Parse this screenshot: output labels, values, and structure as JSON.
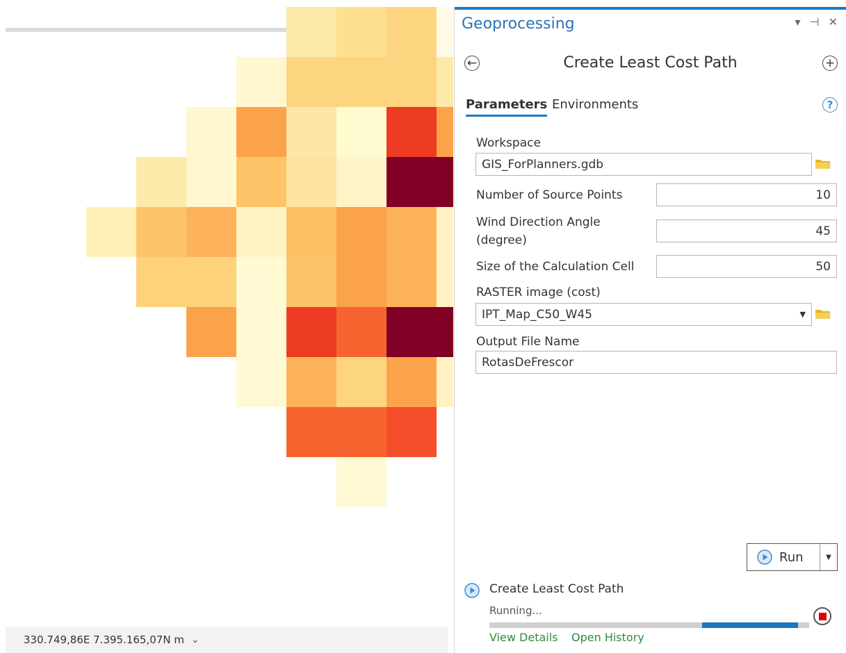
{
  "map": {
    "coordinates": "330.749,86E 7.395.165,07N m",
    "coord_dropdown_icon": "chevron-down-icon",
    "grid": [
      {
        "c": 5,
        "r": 0,
        "color": "#fde9a9"
      },
      {
        "c": 6,
        "r": 0,
        "color": "#fde08f"
      },
      {
        "c": 7,
        "r": 0,
        "color": "#fdd580"
      },
      {
        "c": 8,
        "r": 0,
        "color": "#fffbe6"
      },
      {
        "c": 4,
        "r": 1,
        "color": "#fff7cf"
      },
      {
        "c": 5,
        "r": 1,
        "color": "#fdd580"
      },
      {
        "c": 6,
        "r": 1,
        "color": "#fdd580"
      },
      {
        "c": 7,
        "r": 1,
        "color": "#fdd580"
      },
      {
        "c": 8,
        "r": 1,
        "color": "#fde9a9"
      },
      {
        "c": 3,
        "r": 2,
        "color": "#fff7cf"
      },
      {
        "c": 4,
        "r": 2,
        "color": "#fba34b"
      },
      {
        "c": 5,
        "r": 2,
        "color": "#fde6a7"
      },
      {
        "c": 6,
        "r": 2,
        "color": "#fffbd1"
      },
      {
        "c": 7,
        "r": 2,
        "color": "#ee3b23"
      },
      {
        "c": 8,
        "r": 2,
        "color": "#fba34b"
      },
      {
        "c": 2,
        "r": 3,
        "color": "#fde9a9"
      },
      {
        "c": 3,
        "r": 3,
        "color": "#fff7cf"
      },
      {
        "c": 4,
        "r": 3,
        "color": "#fdc46a"
      },
      {
        "c": 5,
        "r": 3,
        "color": "#fde3a0"
      },
      {
        "c": 6,
        "r": 3,
        "color": "#fff4c7"
      },
      {
        "c": 7,
        "r": 3,
        "color": "#800026"
      },
      {
        "c": 8,
        "r": 3,
        "color": "#800026"
      },
      {
        "c": 1,
        "r": 4,
        "color": "#fff0b8"
      },
      {
        "c": 2,
        "r": 4,
        "color": "#fdc46a"
      },
      {
        "c": 3,
        "r": 4,
        "color": "#fdb35a"
      },
      {
        "c": 4,
        "r": 4,
        "color": "#fff3c4"
      },
      {
        "c": 5,
        "r": 4,
        "color": "#fdbf63"
      },
      {
        "c": 6,
        "r": 4,
        "color": "#fba34b"
      },
      {
        "c": 7,
        "r": 4,
        "color": "#fdb35a"
      },
      {
        "c": 8,
        "r": 4,
        "color": "#fff3c4"
      },
      {
        "c": 2,
        "r": 5,
        "color": "#fdd27a"
      },
      {
        "c": 3,
        "r": 5,
        "color": "#fdd27a"
      },
      {
        "c": 4,
        "r": 5,
        "color": "#fffad4"
      },
      {
        "c": 5,
        "r": 5,
        "color": "#fdc46a"
      },
      {
        "c": 6,
        "r": 5,
        "color": "#fba34b"
      },
      {
        "c": 7,
        "r": 5,
        "color": "#fdb35a"
      },
      {
        "c": 8,
        "r": 5,
        "color": "#fff3c4"
      },
      {
        "c": 3,
        "r": 6,
        "color": "#fba34b"
      },
      {
        "c": 4,
        "r": 6,
        "color": "#fffad4"
      },
      {
        "c": 5,
        "r": 6,
        "color": "#ee3b23"
      },
      {
        "c": 6,
        "r": 6,
        "color": "#f8642f"
      },
      {
        "c": 7,
        "r": 6,
        "color": "#800026"
      },
      {
        "c": 8,
        "r": 6,
        "color": "#800026"
      },
      {
        "c": 4,
        "r": 7,
        "color": "#fffad4"
      },
      {
        "c": 5,
        "r": 7,
        "color": "#fdb35a"
      },
      {
        "c": 6,
        "r": 7,
        "color": "#fdd580"
      },
      {
        "c": 7,
        "r": 7,
        "color": "#fba34b"
      },
      {
        "c": 8,
        "r": 7,
        "color": "#fff3c4"
      },
      {
        "c": 5,
        "r": 8,
        "color": "#f8642f"
      },
      {
        "c": 6,
        "r": 8,
        "color": "#f8642f"
      },
      {
        "c": 7,
        "r": 8,
        "color": "#f44f2a"
      },
      {
        "c": 6,
        "r": 9,
        "color": "#fffad4"
      }
    ]
  },
  "pane": {
    "title": "Geoprocessing",
    "controls": [
      "▾",
      "⊣",
      "✕"
    ],
    "tool_title": "Create Least Cost Path",
    "tabs": [
      "Parameters",
      "Environments"
    ],
    "help": "?",
    "params": {
      "workspace_label": "Workspace",
      "workspace_value": "GIS_ForPlanners.gdb",
      "source_points_label": "Number of Source Points",
      "source_points_value": "10",
      "wind_label_1": "Wind Direction Angle",
      "wind_label_2": "(degree)",
      "wind_value": "45",
      "cell_size_label": "Size of the Calculation Cell",
      "cell_size_value": "50",
      "raster_label": "RASTER image (cost)",
      "raster_value": "IPT_Map_C50_W45",
      "output_label": "Output File Name",
      "output_value": "RotasDeFrescor"
    },
    "run_label": "Run",
    "status": {
      "title": "Create Least Cost Path",
      "state": "Running...",
      "view_details": "View Details",
      "open_history": "Open History"
    }
  },
  "colors": {
    "accent": "#1a7bc3",
    "title_blue": "#2a73b8",
    "link_green": "#2e8b3a",
    "stop_red": "#e00000",
    "folder_yellow": "#e9b526"
  }
}
